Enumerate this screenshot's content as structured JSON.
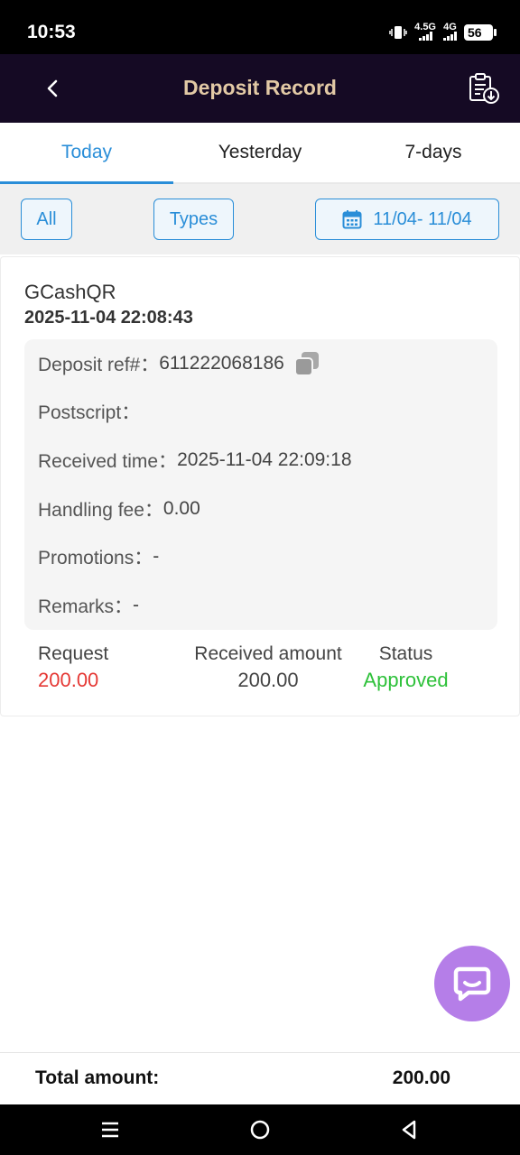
{
  "status_bar": {
    "time": "10:53",
    "network_1": "4.5G",
    "network_2": "4G",
    "battery": "56"
  },
  "header": {
    "title": "Deposit Record",
    "back_icon": "chevron-left-icon",
    "export_icon": "clipboard-download-icon"
  },
  "tabs": [
    {
      "label": "Today",
      "active": true
    },
    {
      "label": "Yesterday",
      "active": false
    },
    {
      "label": "7-days",
      "active": false
    }
  ],
  "filters": {
    "all_label": "All",
    "types_label": "Types",
    "date_range": "11/04- 11/04",
    "date_icon": "calendar-icon"
  },
  "record": {
    "method": "GCashQR",
    "created_time": "2025-11-04 22:08:43",
    "details": {
      "deposit_ref_label": "Deposit ref#：",
      "deposit_ref_value": "611222068186",
      "postscript_label": "Postscript：",
      "postscript_value": "",
      "received_time_label": "Received time：",
      "received_time_value": "2025-11-04 22:09:18",
      "handling_fee_label": "Handling fee：",
      "handling_fee_value": "0.00",
      "promotions_label": "Promotions：",
      "promotions_value": "-",
      "remarks_label": "Remarks：",
      "remarks_value": "-"
    },
    "summary": {
      "request_label": "Request",
      "request_value": "200.00",
      "received_label": "Received amount",
      "received_value": "200.00",
      "status_label": "Status",
      "status_value": "Approved"
    }
  },
  "footer": {
    "total_label": "Total amount:",
    "total_value": "200.00"
  },
  "colors": {
    "accent": "#2a8ed8",
    "header_bg": "#150a24",
    "title": "#e2c9a5",
    "request": "#e53935",
    "approved": "#2ec13a",
    "chat_fab": "#b57ee8"
  }
}
